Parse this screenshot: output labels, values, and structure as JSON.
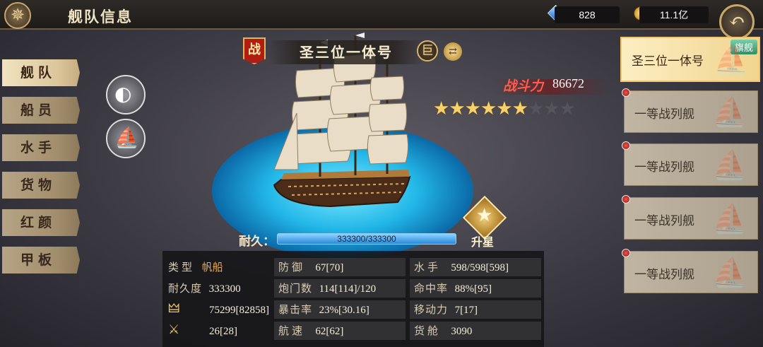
{
  "header": {
    "title": "舰队信息",
    "gems": "828",
    "gold": "11.1亿",
    "back_icon": "back-arrow-icon"
  },
  "nav": {
    "items": [
      {
        "label": "舰队",
        "active": true
      },
      {
        "label": "船员",
        "active": false
      },
      {
        "label": "水手",
        "active": false
      },
      {
        "label": "货物",
        "active": false
      },
      {
        "label": "红颜",
        "active": false
      },
      {
        "label": "甲板",
        "active": false
      }
    ]
  },
  "ship": {
    "name": "圣三位一体号",
    "battle_badge": "战",
    "size_badge": "巨",
    "power_label": "战斗力",
    "power_value": "86672",
    "stars_total": 9,
    "stars_filled": 6,
    "durability_label": "耐久：",
    "durability_value": "333300/333300",
    "durability_fraction": 1.0,
    "upstar_label": "升星"
  },
  "stats": {
    "type_label": "类型",
    "type_value": "帆船",
    "durability_label": "耐久度",
    "durability_value": "333300",
    "attack_value": "75299[82858]",
    "crew_attack_value": "26[28]",
    "defense_label": "防御",
    "defense_value": "67[70]",
    "cannon_label": "炮门数",
    "cannon_value": "114[114]/120",
    "crit_label": "暴击率",
    "crit_value": "23%[30.16]",
    "speed_label": "航速",
    "speed_value": "62[62]",
    "sailors_label": "水手",
    "sailors_value": "598/598[598]",
    "hit_label": "命中率",
    "hit_value": "88%[95]",
    "move_label": "移动力",
    "move_value": "7[17]",
    "cargo_label": "货舱",
    "cargo_value": "3090"
  },
  "ship_list": [
    {
      "name": "圣三位一体号",
      "tag": "旗舰",
      "active": true,
      "alert": false
    },
    {
      "name": "一等战列舰",
      "tag": "",
      "active": false,
      "alert": true
    },
    {
      "name": "一等战列舰",
      "tag": "",
      "active": false,
      "alert": true
    },
    {
      "name": "一等战列舰",
      "tag": "",
      "active": false,
      "alert": true
    },
    {
      "name": "一等战列舰",
      "tag": "",
      "active": false,
      "alert": true
    }
  ],
  "colors": {
    "accent_gold": "#f6d26a",
    "power_red": "#ff5b4a",
    "durability_blue": "#2a88d9",
    "ocean": "#23b8e8"
  }
}
